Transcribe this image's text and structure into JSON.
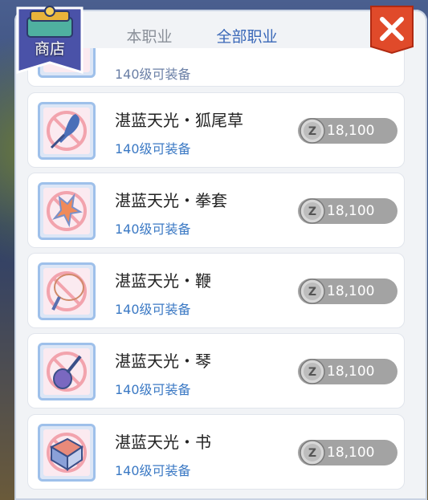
{
  "shop": {
    "badge_label": "商店"
  },
  "tabs": [
    {
      "label": "本职业",
      "active": false
    },
    {
      "label": "全部职业",
      "active": true
    }
  ],
  "close_icon": "close-x",
  "colors": {
    "accent": "#3a68b8",
    "close_red": "#e04a2a",
    "price_bg": "#a3a3a3",
    "req_text": "#3b79c4"
  },
  "items": [
    {
      "name": "",
      "requirement": "140级可装备",
      "price": "",
      "icon": "partial-item-icon"
    },
    {
      "name": "湛蓝天光・狐尾草",
      "requirement": "140级可装备",
      "price": "18,100",
      "icon": "feather-wand-icon"
    },
    {
      "name": "湛蓝天光・拳套",
      "requirement": "140级可装备",
      "price": "18,100",
      "icon": "knuckle-icon"
    },
    {
      "name": "湛蓝天光・鞭",
      "requirement": "140级可装备",
      "price": "18,100",
      "icon": "whip-icon"
    },
    {
      "name": "湛蓝天光・琴",
      "requirement": "140级可装备",
      "price": "18,100",
      "icon": "lute-icon"
    },
    {
      "name": "湛蓝天光・书",
      "requirement": "140级可装备",
      "price": "18,100",
      "icon": "book-icon"
    }
  ],
  "currency_icon": "zeny-coin-icon"
}
